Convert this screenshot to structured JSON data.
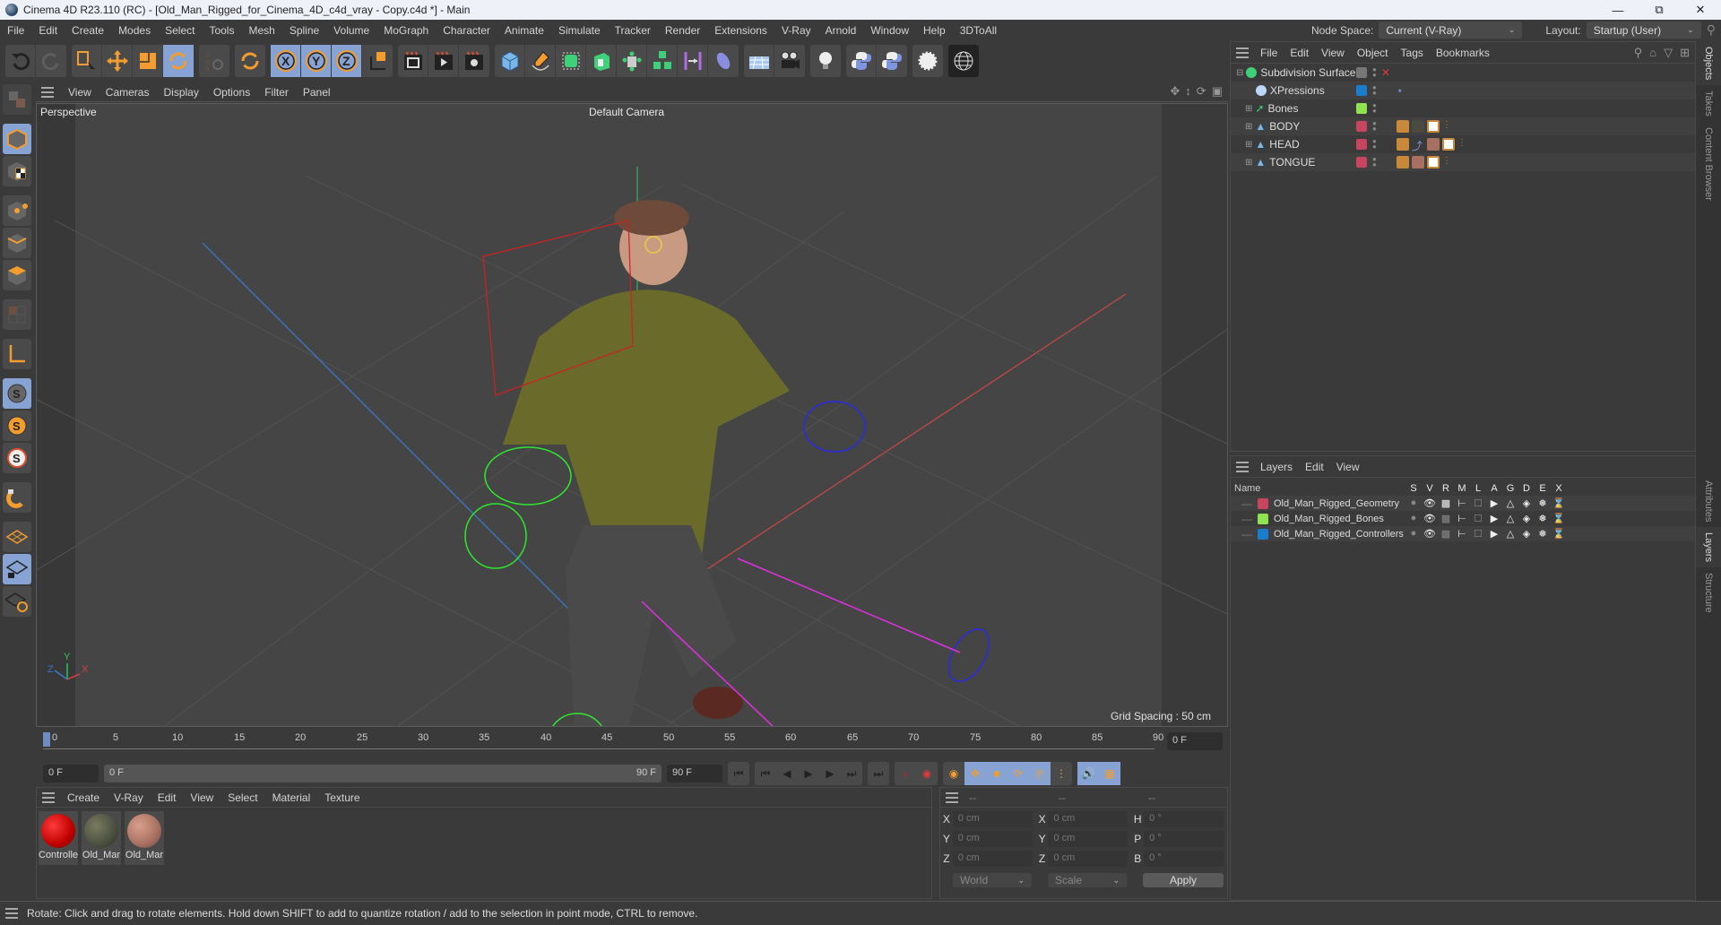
{
  "window": {
    "title": "Cinema 4D R23.110 (RC) - [Old_Man_Rigged_for_Cinema_4D_c4d_vray - Copy.c4d *] - Main",
    "controls": [
      "minimize",
      "restore",
      "close"
    ]
  },
  "menubar": {
    "items": [
      "File",
      "Edit",
      "Create",
      "Modes",
      "Select",
      "Tools",
      "Mesh",
      "Spline",
      "Volume",
      "MoGraph",
      "Character",
      "Animate",
      "Simulate",
      "Tracker",
      "Render",
      "Extensions",
      "V-Ray",
      "Arnold",
      "Window",
      "Help",
      "3DToAll"
    ],
    "node_space_label": "Node Space:",
    "node_space_value": "Current (V-Ray)",
    "layout_label": "Layout:",
    "layout_value": "Startup (User)"
  },
  "toolbar": {
    "groups": [
      [
        "undo-icon",
        "redo-icon"
      ],
      [
        "live-selection-icon",
        "move-icon",
        "scale-icon",
        "rotate-icon"
      ],
      [
        "psr-icon"
      ],
      [
        "recent-tool-icon"
      ],
      [
        "x-axis-lock-icon",
        "y-axis-lock-icon",
        "z-axis-lock-icon",
        "coordinate-system-icon"
      ],
      [
        "render-view-icon",
        "render-picture-viewer-icon",
        "render-settings-icon"
      ],
      [
        "cube-icon",
        "pen-icon",
        "subdivision-icon",
        "extrude-icon",
        "array-icon",
        "cloner-icon",
        "deformer-icon",
        "field-icon"
      ],
      [
        "floor-icon",
        "camera-icon"
      ],
      [
        "light-icon"
      ],
      [
        "python-icon",
        "python-icon-2"
      ],
      [
        "gear-icon"
      ],
      [
        "sphere-wireframe-icon"
      ]
    ],
    "active": [
      "rotate-icon",
      "x-axis-lock-icon",
      "y-axis-lock-icon",
      "z-axis-lock-icon"
    ]
  },
  "left_tools": [
    "make-editable-icon",
    "model-mode-icon",
    "texture-mode-icon",
    "points-mode-icon",
    "edges-mode-icon",
    "polygons-mode-icon",
    "uv-mode-icon",
    "axis-icon",
    "solo-icon",
    "solo-selection-icon",
    "solo-hierarchy-icon",
    "snap-icon",
    "workplane-icon",
    "locked-workplane-icon",
    "workplane-align-icon"
  ],
  "viewport": {
    "menu": [
      "View",
      "Cameras",
      "Display",
      "Options",
      "Filter",
      "Panel"
    ],
    "view_name": "Perspective",
    "camera": "Default Camera",
    "grid_spacing": "Grid Spacing : 50 cm",
    "axis_labels": {
      "x": "X",
      "y": "Y",
      "z": "Z"
    }
  },
  "timeline": {
    "ticks": [
      "0",
      "5",
      "10",
      "15",
      "20",
      "25",
      "30",
      "35",
      "40",
      "45",
      "50",
      "55",
      "60",
      "65",
      "70",
      "75",
      "80",
      "85",
      "90"
    ],
    "current_frame": "0 F",
    "start_field": "0 F",
    "range_start": "0 F",
    "range_end": "90 F",
    "end_field": "90 F"
  },
  "materials": {
    "menu": [
      "Create",
      "V-Ray",
      "Edit",
      "View",
      "Select",
      "Material",
      "Texture"
    ],
    "items": [
      {
        "name": "Controlle",
        "color": "#d40000"
      },
      {
        "name": "Old_Mar",
        "color": "#5a5a48"
      },
      {
        "name": "Old_Mar",
        "color": "#b07a66"
      }
    ]
  },
  "coordinates": {
    "headers": [
      "--",
      "--",
      "--"
    ],
    "rows": [
      {
        "l1": "X",
        "v1": "0 cm",
        "l2": "X",
        "v2": "0 cm",
        "l3": "H",
        "v3": "0 °"
      },
      {
        "l1": "Y",
        "v1": "0 cm",
        "l2": "Y",
        "v2": "0 cm",
        "l3": "P",
        "v3": "0 °"
      },
      {
        "l1": "Z",
        "v1": "0 cm",
        "l2": "Z",
        "v2": "0 cm",
        "l3": "B",
        "v3": "0 °"
      }
    ],
    "space": "World",
    "mode": "Scale",
    "apply_label": "Apply"
  },
  "objects": {
    "menu": [
      "File",
      "Edit",
      "View",
      "Object",
      "Tags",
      "Bookmarks"
    ],
    "items": [
      {
        "name": "Subdivision Surface",
        "color": "#777777",
        "indent": 0
      },
      {
        "name": "XPressions",
        "color": "#1a7ccc",
        "indent": 1
      },
      {
        "name": "Bones",
        "color": "#8ee34f",
        "indent": 1
      },
      {
        "name": "BODY",
        "color": "#c8445f",
        "indent": 1
      },
      {
        "name": "HEAD",
        "color": "#c8445f",
        "indent": 1
      },
      {
        "name": "TONGUE",
        "color": "#c8445f",
        "indent": 1
      }
    ]
  },
  "layers": {
    "menu": [
      "Layers",
      "Edit",
      "View"
    ],
    "columns": [
      "Name",
      "S",
      "V",
      "R",
      "M",
      "L",
      "A",
      "G",
      "D",
      "E",
      "X"
    ],
    "items": [
      {
        "name": "Old_Man_Rigged_Geometry",
        "color": "#c8445f"
      },
      {
        "name": "Old_Man_Rigged_Bones",
        "color": "#8ee34f"
      },
      {
        "name": "Old_Man_Rigged_Controllers",
        "color": "#1a7ccc"
      }
    ]
  },
  "side_tabs_top": [
    "Objects",
    "Takes",
    "Content Browser"
  ],
  "side_tabs_bottom": [
    "Attributes",
    "Layers",
    "Structure"
  ],
  "status": "Rotate: Click and drag to rotate elements. Hold down SHIFT to add to quantize rotation / add to the selection in point mode, CTRL to remove."
}
